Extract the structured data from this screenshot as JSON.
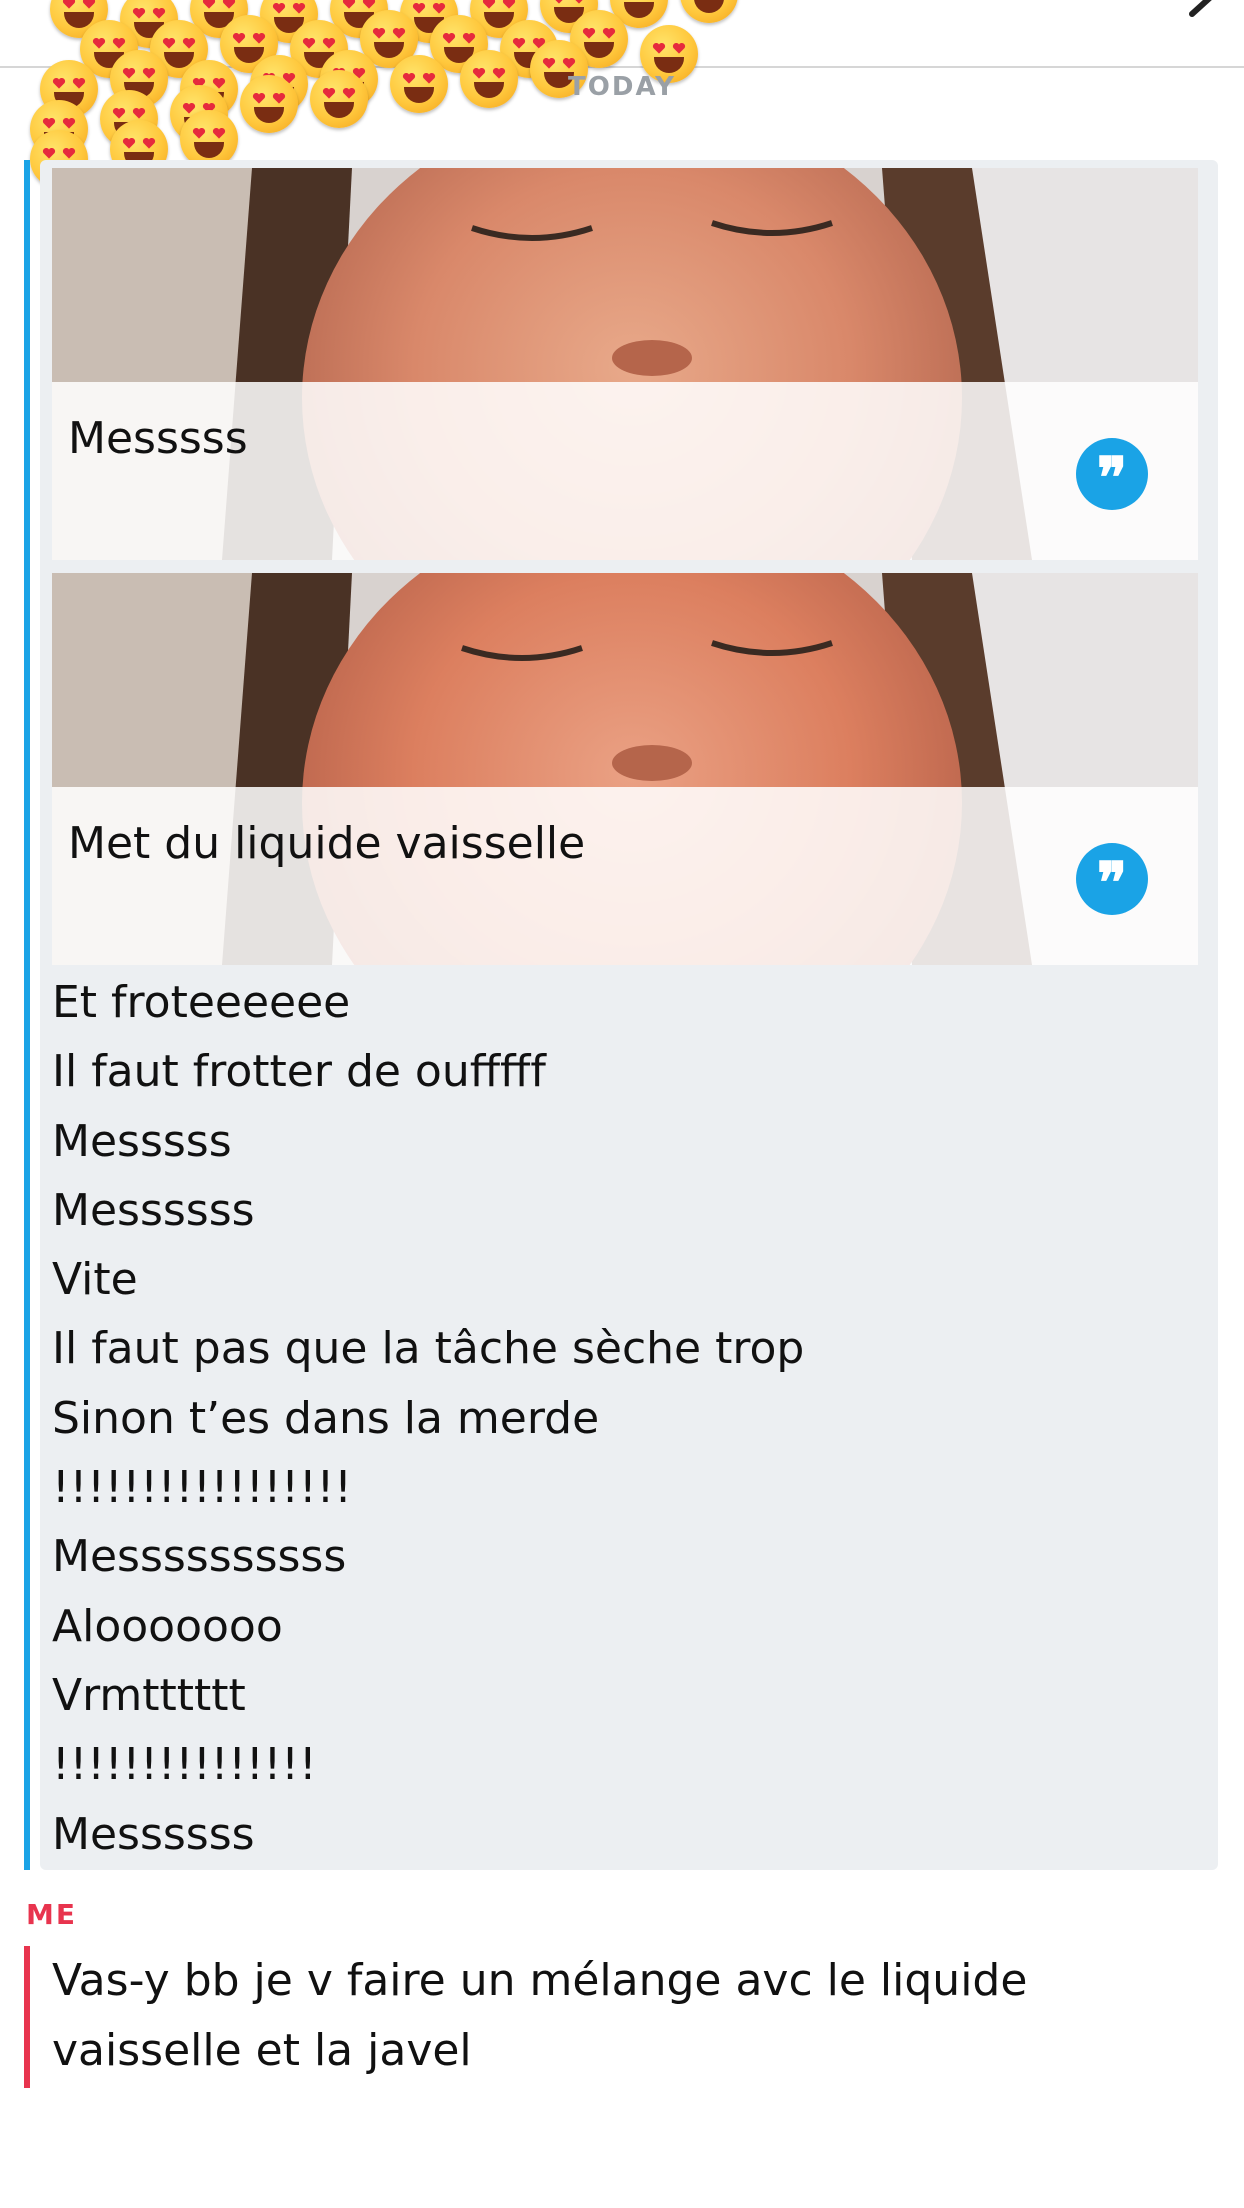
{
  "header": {
    "back_icon": "chevron-right-icon",
    "sticker_icon": "heart-eyes-emoji-icon"
  },
  "chat": {
    "date_separator": "TODAY",
    "them": {
      "color": "#1aa3e6",
      "snaps": [
        {
          "caption": "Messsss",
          "quote_icon": "quote-icon"
        },
        {
          "caption": "Met du liquide vaisselle",
          "quote_icon": "quote-icon"
        }
      ],
      "messages": [
        "Et froteeeeee",
        "Il faut frotter de oufffff",
        "Messsss",
        "Messssss",
        "Vite",
        "Il faut pas que la tâche sèche trop",
        "Sinon t’es dans la merde",
        "!!!!!!!!!!!!!!!!!",
        "Messssssssss",
        "Alooooooo",
        "Vrmtttttt",
        "!!!!!!!!!!!!!!!",
        "Messssss"
      ]
    },
    "me": {
      "label": "ME",
      "color": "#e8344e",
      "message": "Vas-y bb je v faire un mélange avc le liquide vaisselle et la javel"
    }
  }
}
